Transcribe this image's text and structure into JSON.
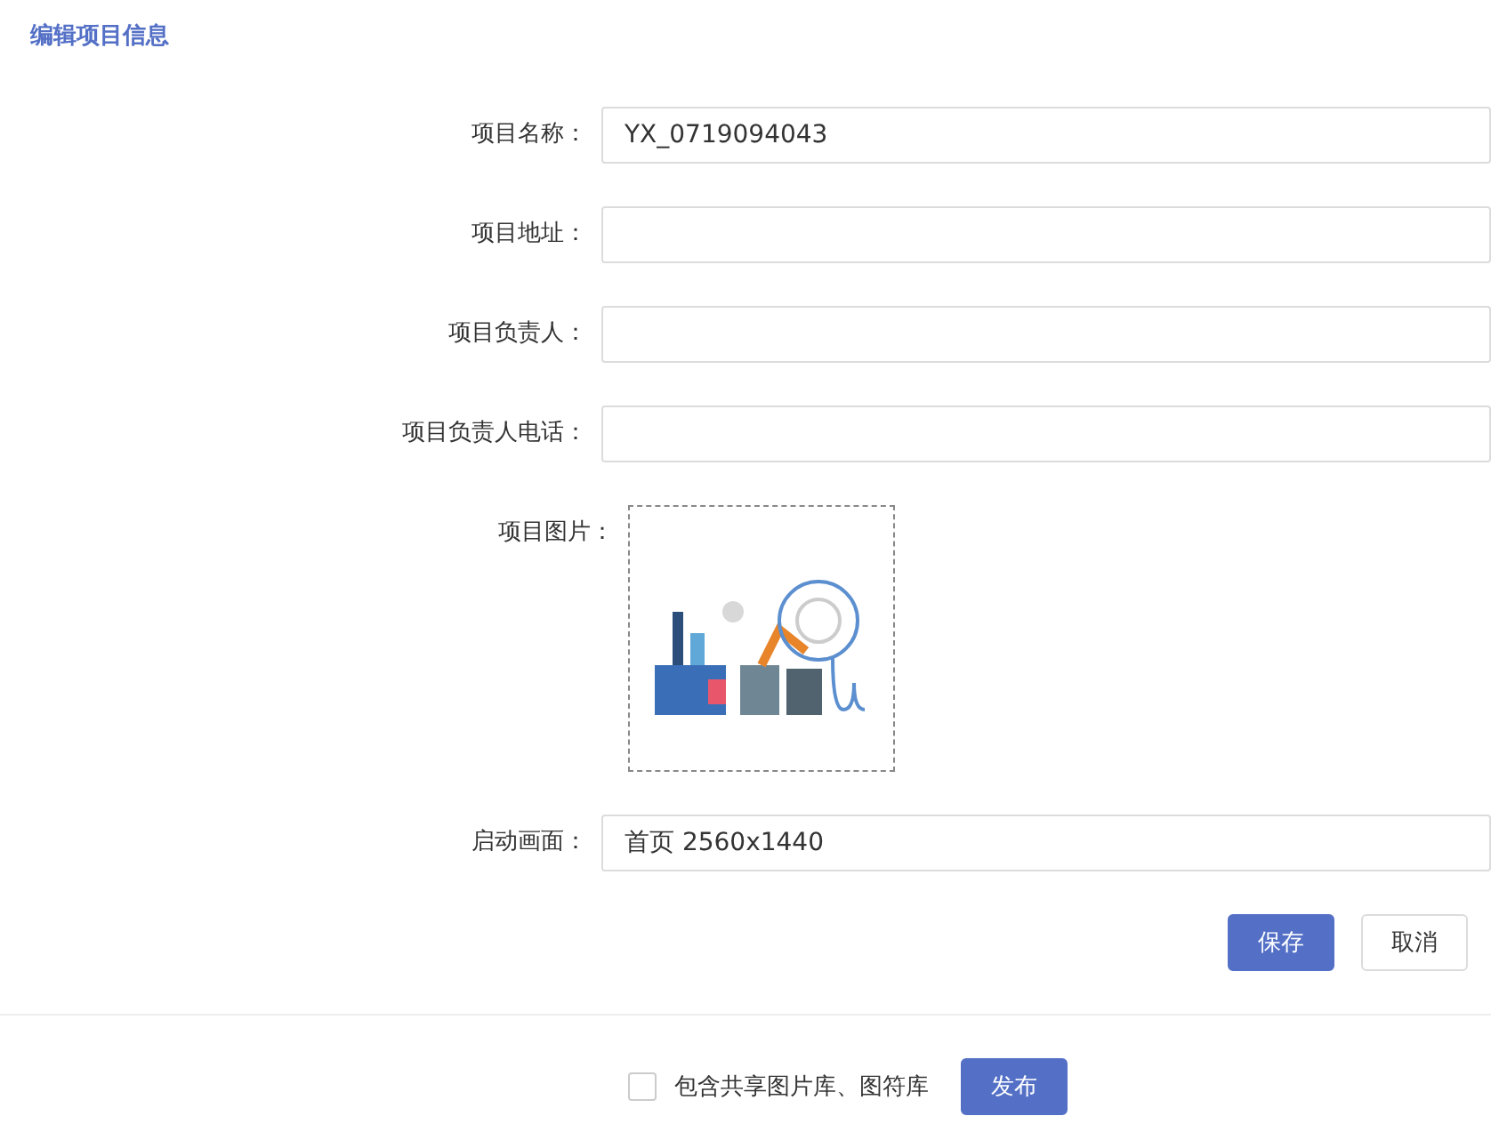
{
  "title": "编辑项目信息",
  "fields": [
    {
      "label": "项目名称：",
      "kind": "text",
      "value": "YX_0719094043"
    },
    {
      "label": "项目地址：",
      "kind": "text"
    },
    {
      "label": "项目负责人：",
      "kind": "text"
    },
    {
      "label": "项目负责人电话：",
      "kind": "text"
    },
    {
      "label": "项目图片："
    },
    {
      "label": "启动画面：",
      "kind": "text",
      "value": "首页 2560x1440"
    }
  ],
  "buttons": [
    {
      "label": "保存",
      "kind": "primary"
    },
    {
      "label": "取消",
      "kind": "default"
    }
  ],
  "footer": {
    "checkbox": {
      "label": "包含共享图片库、图符库",
      "checked": false
    },
    "publish": "发布"
  }
}
